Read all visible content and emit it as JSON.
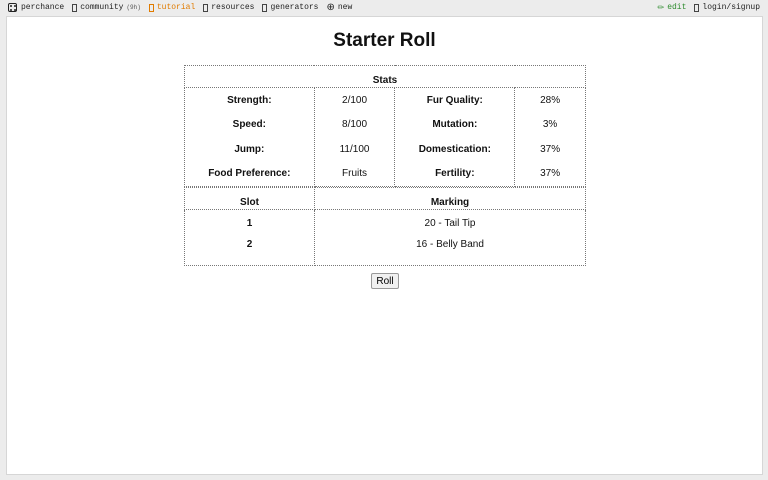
{
  "nav": {
    "brand": "perchance",
    "community": "community",
    "community_count": "(9h)",
    "tutorial": "tutorial",
    "resources": "resources",
    "generators": "generators",
    "new": "new",
    "edit": "edit",
    "login": "login/signup",
    "colors": {
      "tutorial": "#e07b00",
      "edit": "#2e8b2e"
    }
  },
  "page": {
    "title": "Starter Roll",
    "roll_label": "Roll"
  },
  "stats": {
    "header": "Stats",
    "left_labels": [
      "Strength:",
      "Speed:",
      "Jump:",
      "Food Preference:"
    ],
    "left_values": [
      "2/100",
      "8/100",
      "11/100",
      "Fruits"
    ],
    "right_labels": [
      "Fur Quality:",
      "Mutation:",
      "Domestication:",
      "Fertility:"
    ],
    "right_values": [
      "28%",
      "3%",
      "37%",
      "37%"
    ]
  },
  "markings": {
    "slot_header": "Slot",
    "marking_header": "Marking",
    "rows": [
      {
        "slot": "1",
        "marking": "20 - Tail Tip"
      },
      {
        "slot": "2",
        "marking": "16 - Belly Band"
      }
    ]
  }
}
